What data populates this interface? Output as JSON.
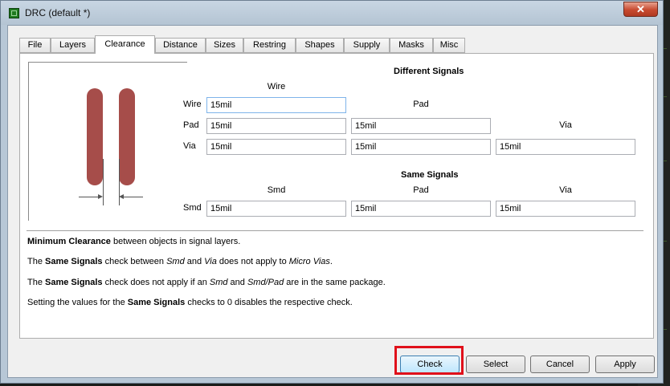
{
  "window": {
    "title": "DRC (default *)",
    "close_glyph": "✕"
  },
  "tabs": [
    {
      "label": "File"
    },
    {
      "label": "Layers"
    },
    {
      "label": "Clearance"
    },
    {
      "label": "Distance"
    },
    {
      "label": "Sizes"
    },
    {
      "label": "Restring"
    },
    {
      "label": "Shapes"
    },
    {
      "label": "Supply"
    },
    {
      "label": "Masks"
    },
    {
      "label": "Misc"
    }
  ],
  "active_tab": "Clearance",
  "clearance": {
    "different_signals": {
      "heading": "Different Signals",
      "col_wire": "Wire",
      "col_pad": "Pad",
      "col_via": "Via",
      "row_wire": "Wire",
      "row_pad": "Pad",
      "row_via": "Via",
      "wire_wire": "15mil",
      "pad_wire": "15mil",
      "pad_pad": "15mil",
      "via_wire": "15mil",
      "via_pad": "15mil",
      "via_via": "15mil"
    },
    "same_signals": {
      "heading": "Same Signals",
      "col_smd": "Smd",
      "col_pad": "Pad",
      "col_via": "Via",
      "row_smd": "Smd",
      "smd_smd": "15mil",
      "smd_pad": "15mil",
      "smd_via": "15mil"
    },
    "info": [
      {
        "b1": "Minimum Clearance",
        "t1": " between objects in signal layers."
      },
      {
        "t0": "The ",
        "b1": "Same Signals",
        "t1": " check between ",
        "i1": "Smd",
        "t2": " and ",
        "i2": "Via",
        "t3": " does not apply to ",
        "i3": "Micro Vias",
        "t4": "."
      },
      {
        "t0": "The ",
        "b1": "Same Signals",
        "t1": " check does not apply if an ",
        "i1": "Smd",
        "t2": " and ",
        "i2": "Smd/Pad",
        "t3": " are in the same package."
      },
      {
        "t0": "Setting the values for the ",
        "b1": "Same Signals",
        "t1": " checks to 0 disables the respective check."
      }
    ]
  },
  "buttons": {
    "check": "Check",
    "select": "Select",
    "cancel": "Cancel",
    "apply": "Apply"
  },
  "colors": {
    "signal_trace": "#a64d4a",
    "highlight_box": "#e0101a",
    "window_frame": "#b7c7d6"
  },
  "icons": {
    "app": "eagle-app-icon",
    "close": "close-icon"
  }
}
